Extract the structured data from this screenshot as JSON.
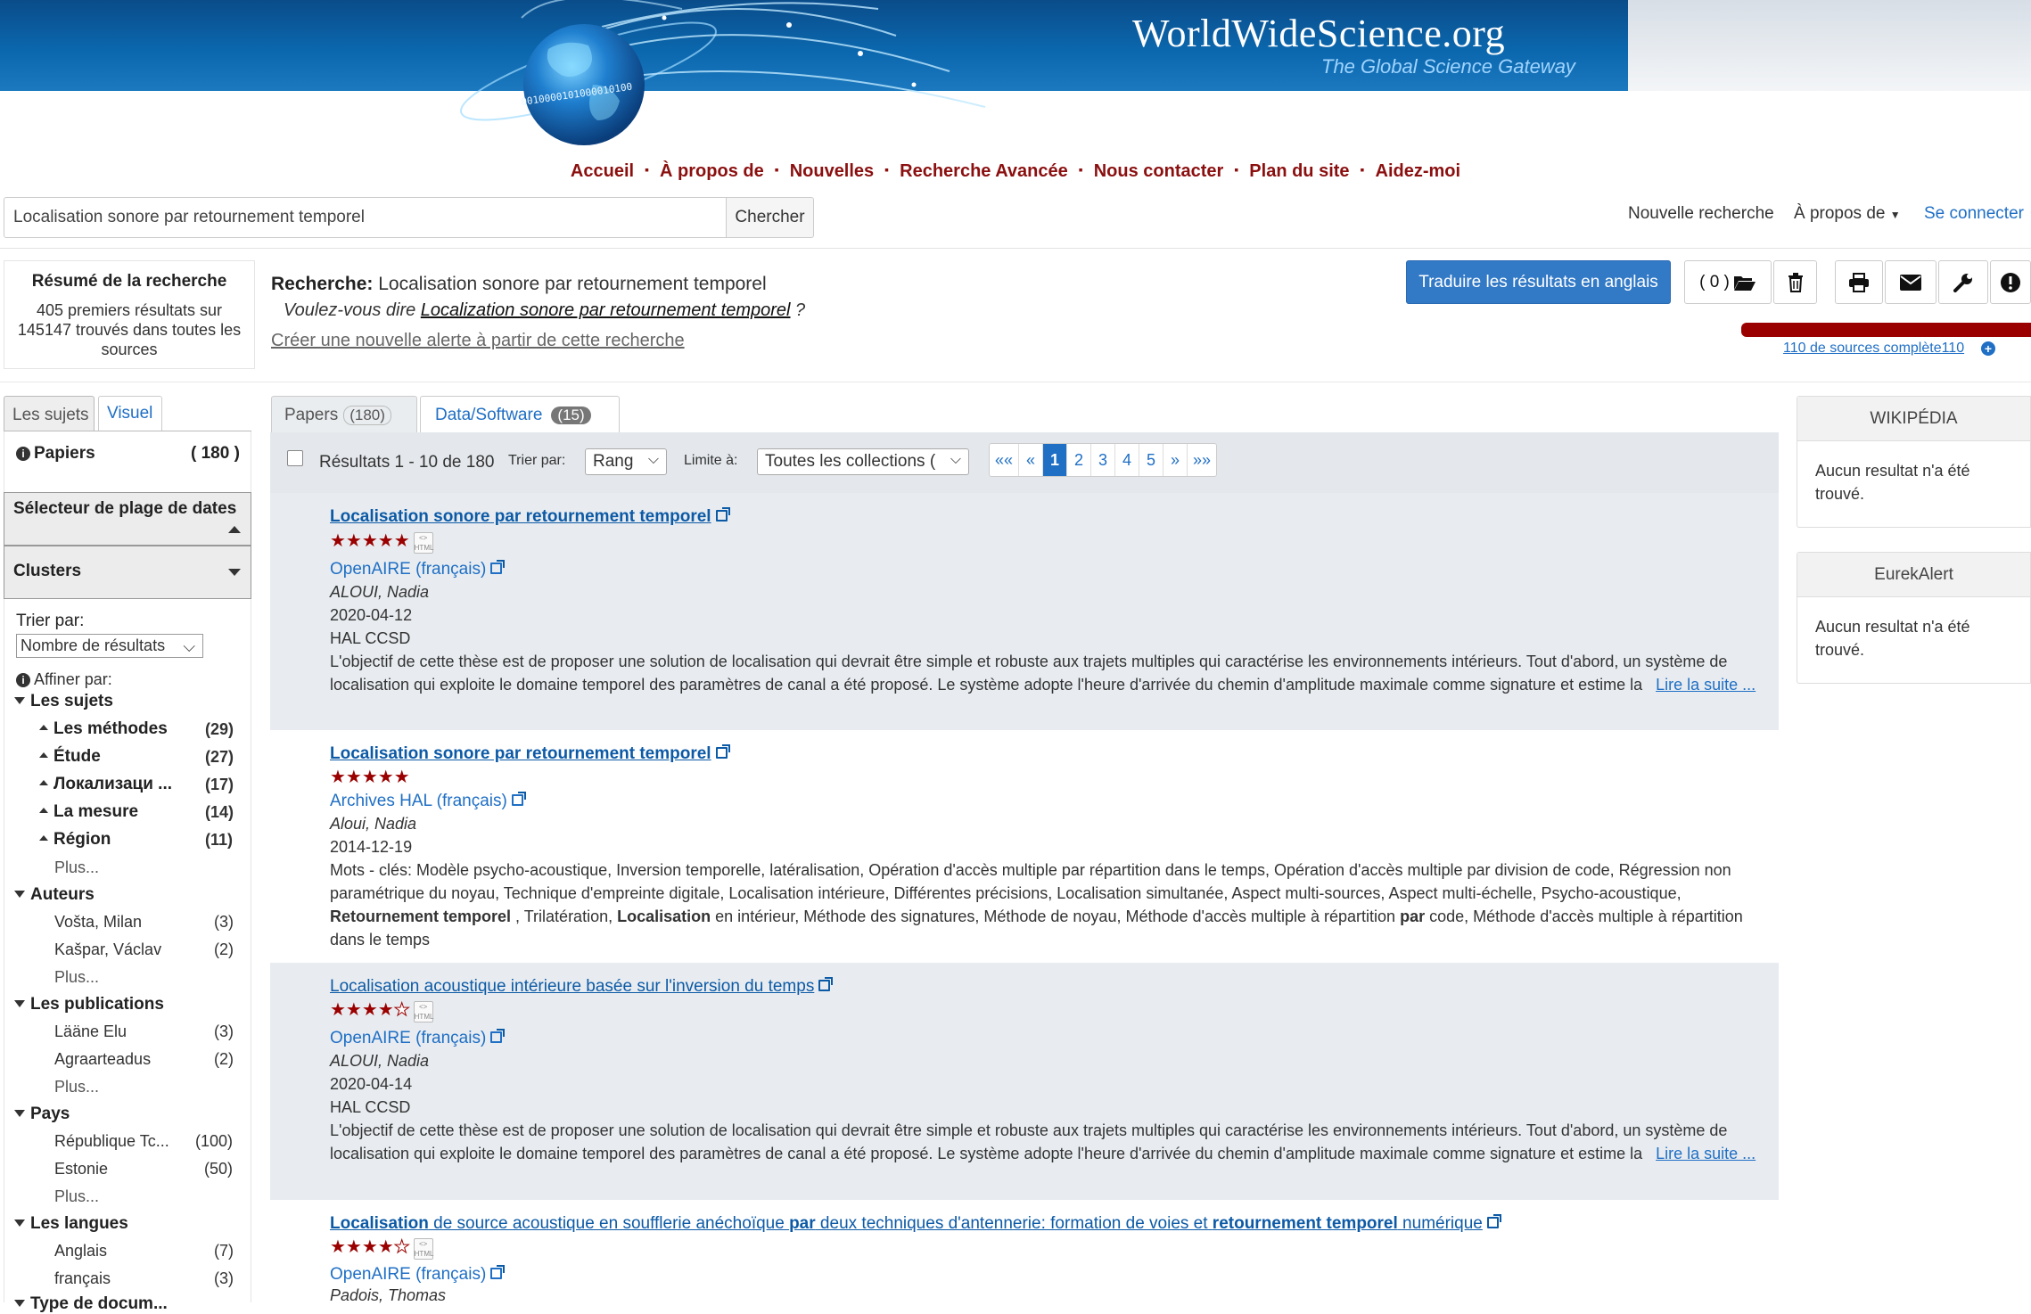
{
  "banner": {
    "title": "WorldWideScience.org",
    "tagline": "The Global Science Gateway",
    "globe_digits": "0010000101000010100"
  },
  "main_nav": [
    "Accueil",
    "À propos de",
    "Nouvelles",
    "Recherche Avancée",
    "Nous contacter",
    "Plan du site",
    "Aidez-moi"
  ],
  "nav_separator": "▪",
  "search": {
    "value": "Localisation sonore par retournement temporel",
    "button": "Chercher"
  },
  "top_nav": {
    "new_search": "Nouvelle recherche",
    "about": "À propos de",
    "login": "Se connecter"
  },
  "summary": {
    "title": "Résumé de la recherche",
    "text": "405 premiers résultats sur 145147 trouvés dans toutes les sources"
  },
  "search_header": {
    "label": "Recherche:",
    "query": "Localisation sonore par retournement temporel",
    "didyoumean_prefix": "Voulez-vous dire",
    "didyoumean_link": "Localization sonore par retournement temporel",
    "didyoumean_suffix": "?",
    "create_alert": "Créer une nouvelle alerte à partir de cette recherche"
  },
  "toolbar": {
    "translate": "Traduire les résultats en anglais",
    "folder_count": "( 0 )",
    "icons": [
      "folder-open-icon",
      "trash-icon",
      "print-icon",
      "mail-icon",
      "wrench-icon",
      "info-icon"
    ]
  },
  "sources": {
    "progress": 1.0,
    "link": "110 de sources complète110",
    "color": "#9b0000"
  },
  "sidebar": {
    "tabs": [
      "Les sujets",
      "Visuel"
    ],
    "papers_label": "Papiers",
    "papers_count": "( 180 )",
    "date_selector": "Sélecteur de plage de dates",
    "clusters": "Clusters",
    "sort_label": "Trier par:",
    "sort_value": "Nombre de résultats",
    "refine_label": "Affiner par:",
    "groups": [
      {
        "title": "Les sujets",
        "items": [
          {
            "label": "Les méthodes",
            "count": "(29)"
          },
          {
            "label": "Étude",
            "count": "(27)"
          },
          {
            "label": "Локализаци ...",
            "count": "(17)"
          },
          {
            "label": "La mesure",
            "count": "(14)"
          },
          {
            "label": "Région",
            "count": "(11)"
          }
        ],
        "more": "Plus..."
      },
      {
        "title": "Auteurs",
        "items": [
          {
            "label": "Vošta, Milan",
            "count": "(3)"
          },
          {
            "label": "Kašpar, Václav",
            "count": "(2)"
          }
        ],
        "more": "Plus..."
      },
      {
        "title": "Les publications",
        "items": [
          {
            "label": "Lääne Elu",
            "count": "(3)"
          },
          {
            "label": "Agraarteadus",
            "count": "(2)"
          }
        ],
        "more": "Plus..."
      },
      {
        "title": "Pays",
        "items": [
          {
            "label": "République Tc...",
            "count": "(100)"
          },
          {
            "label": "Estonie",
            "count": "(50)"
          }
        ],
        "more": "Plus..."
      },
      {
        "title": "Les langues",
        "items": [
          {
            "label": "Anglais",
            "count": "(7)"
          },
          {
            "label": "français",
            "count": "(3)"
          }
        ]
      },
      {
        "title": "Type de docum..."
      }
    ]
  },
  "results": {
    "tabs": [
      {
        "label": "Papers",
        "count": "(180)"
      },
      {
        "label": "Data/Software",
        "count": "(15)"
      }
    ],
    "range": "Résultats 1 - 10 de 180",
    "sort_label": "Trier par:",
    "sort_value": "Rang",
    "limit_label": "Limite à:",
    "limit_value": "Toutes les collections (",
    "pager": [
      "««",
      "«",
      "1",
      "2",
      "3",
      "4",
      "5",
      "»",
      "»»"
    ],
    "active_page": "1",
    "items": [
      {
        "title": "Localisation sonore par retournement temporel",
        "rating": 5,
        "source": "OpenAIRE (français)",
        "author": "ALOUI, Nadia",
        "date": "2020-04-12",
        "publisher": "HAL CCSD",
        "abstract": "L'objectif de cette thèse est de proposer une solution de localisation qui devrait être simple et robuste aux trajets multiples qui caractérise les environnements intérieurs. Tout d'abord, un système de localisation qui exploite le domaine temporel des paramètres de canal a été proposé. Le système adopte l'heure d'arrivée du chemin d'amplitude maximale comme signature et estime la",
        "read_more": "Lire la suite ..."
      },
      {
        "title": "Localisation sonore par retournement temporel",
        "rating": 5,
        "source": "Archives HAL (français)",
        "author": "Aloui, Nadia",
        "date": "2014-12-19",
        "keywords_a": "Mots - clés: Modèle psycho-acoustique, Inversion temporelle, latéralisation, Opération d'accès multiple par répartition dans le temps, Opération d'accès multiple par division de code, Régression non paramétrique du noyau, Technique d'empreinte digitale, Localisation intérieure, Différentes précisions, Localisation simultanée, Aspect multi-sources, Aspect multi-échelle, Psycho-acoustique,",
        "kw_bold1": "Retournement temporel",
        "kw_mid1": ", Trilatération,",
        "kw_bold2": "Localisation",
        "kw_mid2": "en intérieur, Méthode des signatures, Méthode de noyau, Méthode d'accès multiple à répartition",
        "kw_bold3": "par",
        "kw_end": "code, Méthode d'accès multiple à répartition dans le temps"
      },
      {
        "title": "Localisation acoustique intérieure basée sur l'inversion du temps",
        "rating": 4,
        "source": "OpenAIRE (français)",
        "author": "ALOUI, Nadia",
        "date": "2020-04-14",
        "publisher": "HAL CCSD",
        "abstract": "L'objectif de cette thèse est de proposer une solution de localisation qui devrait être simple et robuste aux trajets multiples qui caractérise les environnements intérieurs. Tout d'abord, un système de localisation qui exploite le domaine temporel des paramètres de canal a été proposé. Le système adopte l'heure d'arrivée du chemin d'amplitude maximale comme signature et estime la",
        "read_more": "Lire la suite ..."
      },
      {
        "title_parts": [
          "Localisation",
          " de source acoustique en soufflerie anéchoïque ",
          "par",
          " deux techniques d'antennerie: formation de voies et ",
          "retournement temporel",
          " numérique"
        ],
        "rating": 4,
        "source": "OpenAIRE (français)",
        "author": "Padois, Thomas"
      }
    ]
  },
  "right_sidebar": [
    {
      "title": "WIKIPÉDIA",
      "text": "Aucun resultat n'a été trouvé."
    },
    {
      "title": "EurekAlert",
      "text": "Aucun resultat n'a été trouvé."
    }
  ],
  "html_badge": "HTML"
}
